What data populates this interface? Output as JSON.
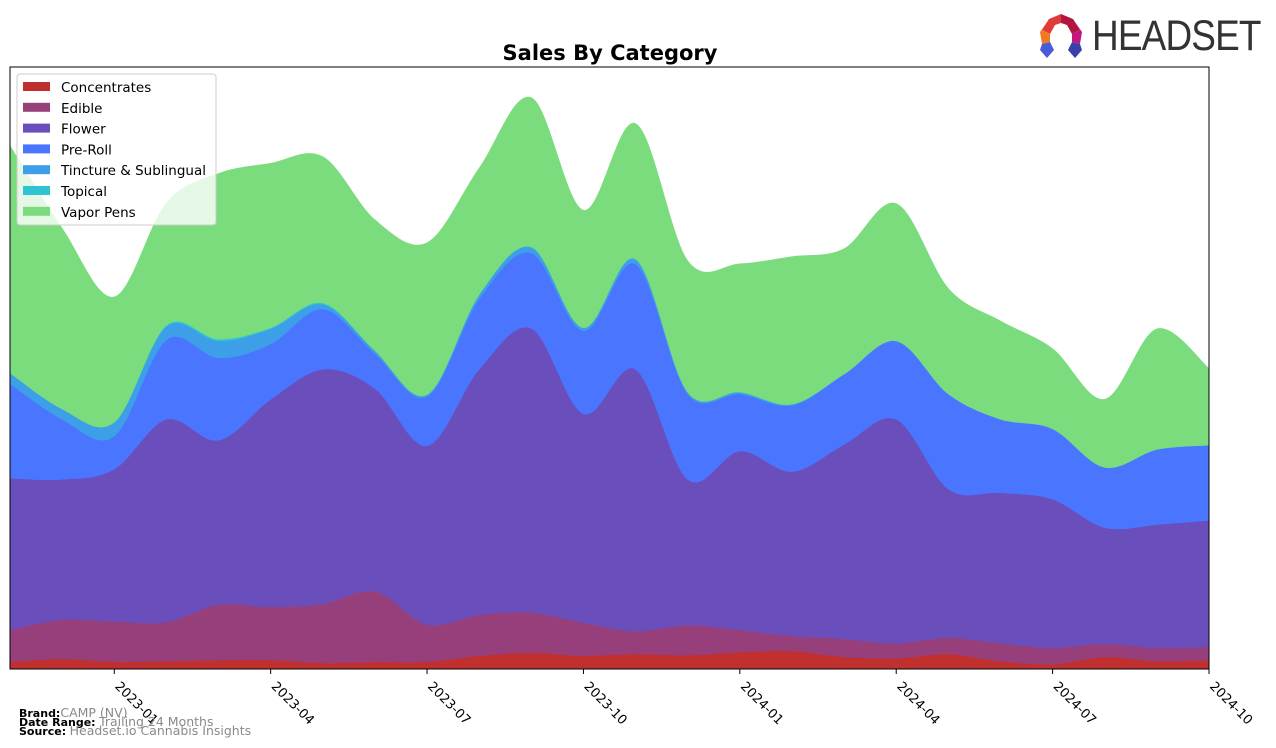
{
  "logo": {
    "text": "HEADSET",
    "icon": "headset-logo-icon"
  },
  "footer": {
    "brand_label": "Brand:",
    "brand_value": "CAMP (NV)",
    "date_range_label": "Date Range:",
    "date_range_value": "Trailing 24 Months",
    "source_label": "Source:",
    "source_value": "Headset.io Cannabis Insights"
  },
  "chart_data": {
    "type": "area",
    "stacked": true,
    "smoothed": true,
    "title": "Sales By Category",
    "xlabel": "",
    "ylabel": "",
    "y_units": "relative (unlabeled axis)",
    "ylim": [
      0,
      100
    ],
    "grid": false,
    "legend_position": "top-left",
    "x": [
      "2022-11",
      "2022-12",
      "2023-01",
      "2023-02",
      "2023-03",
      "2023-04",
      "2023-05",
      "2023-06",
      "2023-07",
      "2023-08",
      "2023-09",
      "2023-10",
      "2023-11",
      "2023-12",
      "2024-01",
      "2024-02",
      "2024-03",
      "2024-04",
      "2024-05",
      "2024-06",
      "2024-07",
      "2024-08",
      "2024-09",
      "2024-10"
    ],
    "x_tick_labels": [
      "2023-01",
      "2023-04",
      "2023-07",
      "2023-10",
      "2024-01",
      "2024-04",
      "2024-07",
      "2024-10"
    ],
    "series": [
      {
        "name": "Concentrates",
        "color": "#c0302f",
        "values": [
          1.2,
          1.7,
          1.2,
          1.3,
          1.5,
          1.5,
          1.0,
          1.2,
          1.2,
          2.2,
          2.7,
          2.2,
          2.5,
          2.3,
          2.8,
          3.0,
          2.0,
          1.8,
          2.5,
          1.3,
          0.8,
          2.0,
          1.3,
          1.5
        ]
      },
      {
        "name": "Edible",
        "color": "#973f7a",
        "values": [
          5.3,
          6.5,
          6.7,
          6.5,
          9.2,
          8.8,
          9.8,
          11.7,
          6.2,
          6.8,
          6.7,
          5.5,
          3.8,
          5.0,
          3.7,
          2.5,
          3.0,
          2.5,
          2.7,
          3.0,
          2.7,
          2.2,
          2.2,
          2.2
        ]
      },
      {
        "name": "Flower",
        "color": "#6a4ebc",
        "values": [
          25.2,
          23.3,
          25.3,
          33.7,
          27.3,
          34.5,
          39.0,
          33.7,
          29.7,
          40.8,
          47.2,
          34.7,
          43.5,
          24.2,
          29.7,
          27.3,
          32.3,
          37.2,
          24.7,
          25.0,
          24.7,
          19.3,
          20.5,
          21.0
        ]
      },
      {
        "name": "Pre-Roll",
        "color": "#4a76ff",
        "values": [
          15.7,
          10.0,
          5.5,
          13.2,
          13.7,
          9.2,
          10.0,
          5.8,
          8.2,
          11.7,
          12.5,
          13.8,
          17.5,
          14.2,
          9.5,
          11.0,
          11.7,
          13.0,
          15.8,
          12.2,
          11.7,
          10.0,
          12.5,
          12.5
        ]
      },
      {
        "name": "Tincture & Sublingual",
        "color": "#3d9fe8",
        "values": [
          1.8,
          1.7,
          2.3,
          2.2,
          2.8,
          2.5,
          0.8,
          0.5,
          0.3,
          0.7,
          1.0,
          0.5,
          0.8,
          0.3,
          0.3,
          0.2,
          0,
          0,
          0,
          0,
          0,
          0,
          0,
          0
        ]
      },
      {
        "name": "Topical",
        "color": "#2ec4d4",
        "values": [
          0,
          0,
          0,
          0.2,
          0.3,
          0.2,
          0.2,
          0,
          0,
          0,
          0,
          0,
          0,
          0,
          0,
          0,
          0,
          0,
          0,
          0,
          0,
          0,
          0,
          0
        ]
      },
      {
        "name": "Vapor Pens",
        "color": "#7bdc7d",
        "values": [
          37.7,
          30.0,
          20.8,
          20.3,
          27.5,
          27.3,
          24.3,
          21.7,
          25.2,
          21.0,
          24.8,
          19.5,
          22.5,
          21.8,
          21.3,
          24.5,
          20.8,
          22.8,
          17.5,
          16.3,
          13.3,
          11.3,
          20.0,
          12.7
        ]
      }
    ]
  }
}
